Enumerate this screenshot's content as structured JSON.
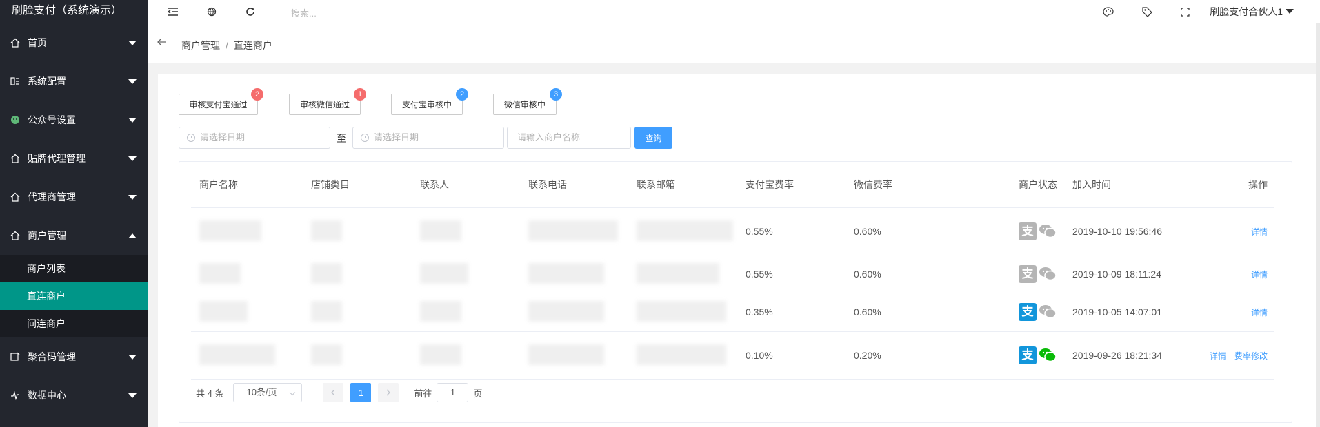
{
  "app": {
    "title": "刷脸支付（系统演示）"
  },
  "sidebar": {
    "items": [
      {
        "label": "首页",
        "icon": "home-icon"
      },
      {
        "label": "系统配置",
        "icon": "settings-icon"
      },
      {
        "label": "公众号设置",
        "icon": "wechat-icon"
      },
      {
        "label": "贴牌代理管理",
        "icon": "home-icon"
      },
      {
        "label": "代理商管理",
        "icon": "home-icon"
      },
      {
        "label": "商户管理",
        "icon": "home-icon"
      },
      {
        "label": "聚合码管理",
        "icon": "qrcode-icon"
      },
      {
        "label": "数据中心",
        "icon": "chart-icon"
      }
    ],
    "sub_items": [
      {
        "label": "商户列表"
      },
      {
        "label": "直连商户"
      },
      {
        "label": "间连商户"
      }
    ],
    "active_color": "#009688"
  },
  "topbar": {
    "search_placeholder": "搜索...",
    "user": "刷脸支付合伙人1"
  },
  "breadcrumb": {
    "parent": "商户管理",
    "sep": "/",
    "current": "直连商户"
  },
  "filters": {
    "buttons": [
      {
        "label": "审核支付宝通过",
        "badge": "2",
        "badge_color": "#f56c6c"
      },
      {
        "label": "审核微信通过",
        "badge": "1",
        "badge_color": "#f56c6c"
      },
      {
        "label": "支付宝审核中",
        "badge": "2",
        "badge_color": "#409eff"
      },
      {
        "label": "微信审核中",
        "badge": "3",
        "badge_color": "#409eff"
      }
    ],
    "date_placeholder": "请选择日期",
    "to_label": "至",
    "name_placeholder": "请输入商户名称",
    "query_label": "查询"
  },
  "table": {
    "headers": [
      "商户名称",
      "店铺类目",
      "联系人",
      "联系电话",
      "联系邮箱",
      "支付宝费率",
      "微信费率",
      "商户状态",
      "加入时间",
      "操作"
    ],
    "rows": [
      {
        "alipay_rate": "0.55%",
        "wechat_rate": "0.60%",
        "alipay_active": false,
        "wechat_active": false,
        "joined": "2019-10-10 19:56:46",
        "ops": [
          "详情"
        ]
      },
      {
        "alipay_rate": "0.55%",
        "wechat_rate": "0.60%",
        "alipay_active": false,
        "wechat_active": false,
        "joined": "2019-10-09 18:11:24",
        "ops": [
          "详情"
        ]
      },
      {
        "alipay_rate": "0.35%",
        "wechat_rate": "0.60%",
        "alipay_active": true,
        "wechat_active": false,
        "joined": "2019-10-05 14:07:01",
        "ops": [
          "详情"
        ]
      },
      {
        "alipay_rate": "0.10%",
        "wechat_rate": "0.20%",
        "alipay_active": true,
        "wechat_active": true,
        "joined": "2019-09-26 18:21:34",
        "ops": [
          "详情",
          "费率修改"
        ]
      }
    ]
  },
  "pager": {
    "total": "共 4 条",
    "size": "10条/页",
    "current_page": "1",
    "goto_label": "前往",
    "goto_value": "1",
    "page_label": "页"
  },
  "colors": {
    "primary": "#409eff",
    "sidebar_bg": "#23262e",
    "alipay": "#1296db",
    "wechat": "#09bb07"
  }
}
